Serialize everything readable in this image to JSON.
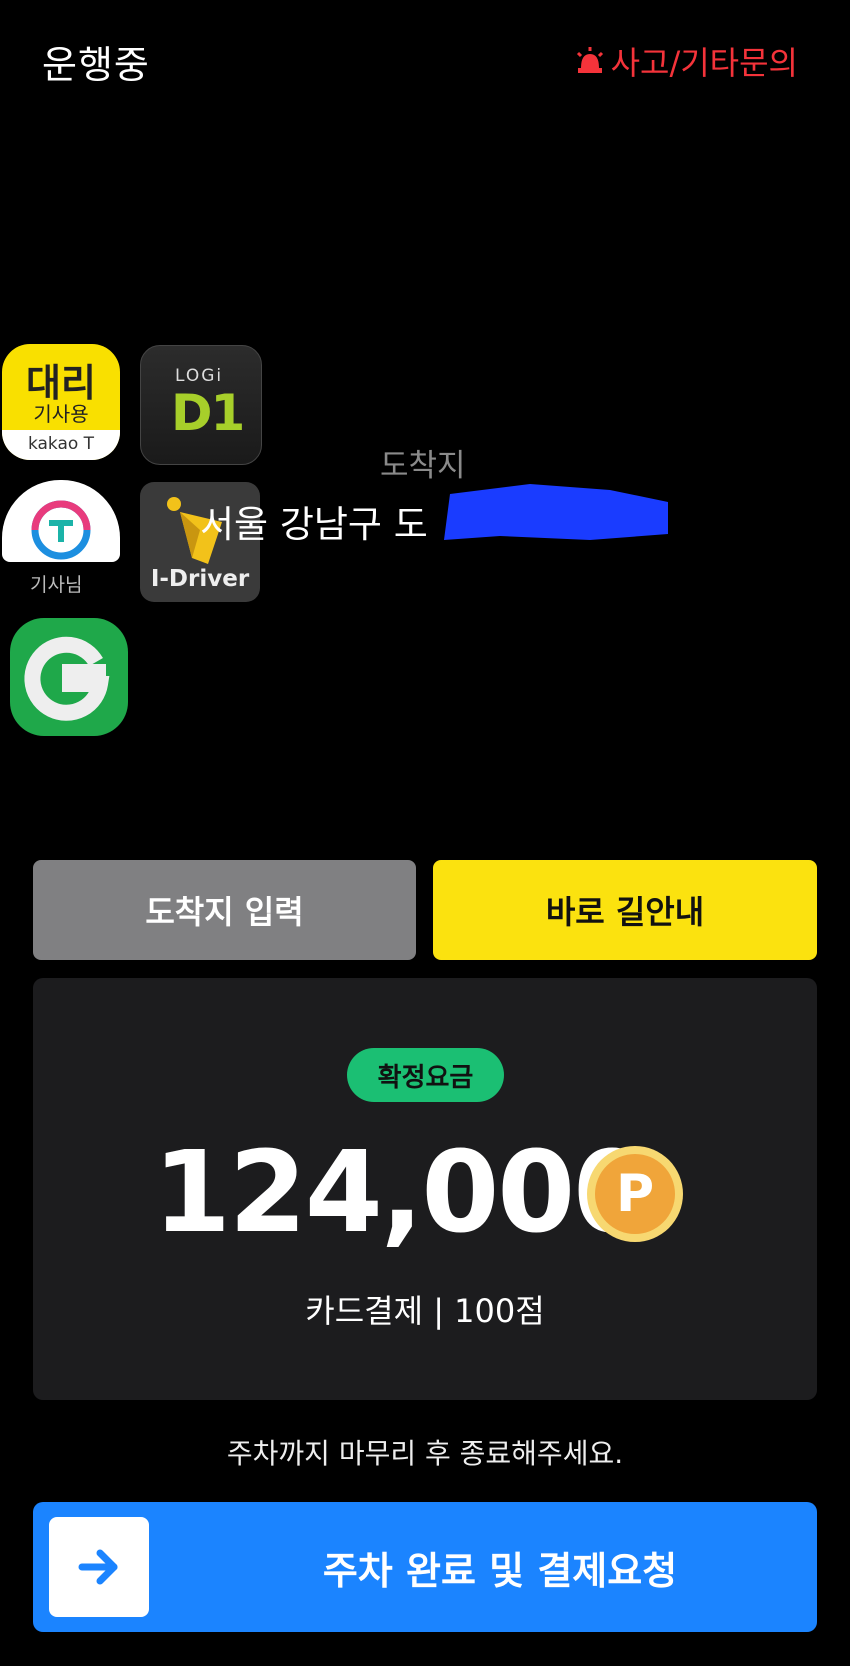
{
  "header": {
    "status": "운행중",
    "report_link": "사고/기타문의",
    "report_icon": "siren-icon"
  },
  "apps": {
    "kakao_title": "대리",
    "kakao_sub": "기사용",
    "kakao_brand": "kakao T",
    "logi_small": "LOGi",
    "logi_big": "D1",
    "tdriver_label": "기사님",
    "idriver_label": "I-Driver"
  },
  "destination": {
    "label": "도착지",
    "address": "서울 강남구 도"
  },
  "buttons": {
    "enter_destination": "도착지 입력",
    "navigate_now": "바로 길안내"
  },
  "fare": {
    "badge": "확정요금",
    "amount": "124,000",
    "point_symbol": "P",
    "detail": "카드결제 | 100점"
  },
  "instruction": "주차까지 마무리 후 종료해주세요.",
  "complete_button": {
    "label": "주차 완료 및 결제요청",
    "icon": "arrow-right-icon"
  },
  "colors": {
    "background": "#000000",
    "alert_red": "#f4333a",
    "nav_yellow": "#fbe20f",
    "badge_green": "#1bbf73",
    "primary_blue": "#1b84ff",
    "gray_button": "#808082"
  }
}
